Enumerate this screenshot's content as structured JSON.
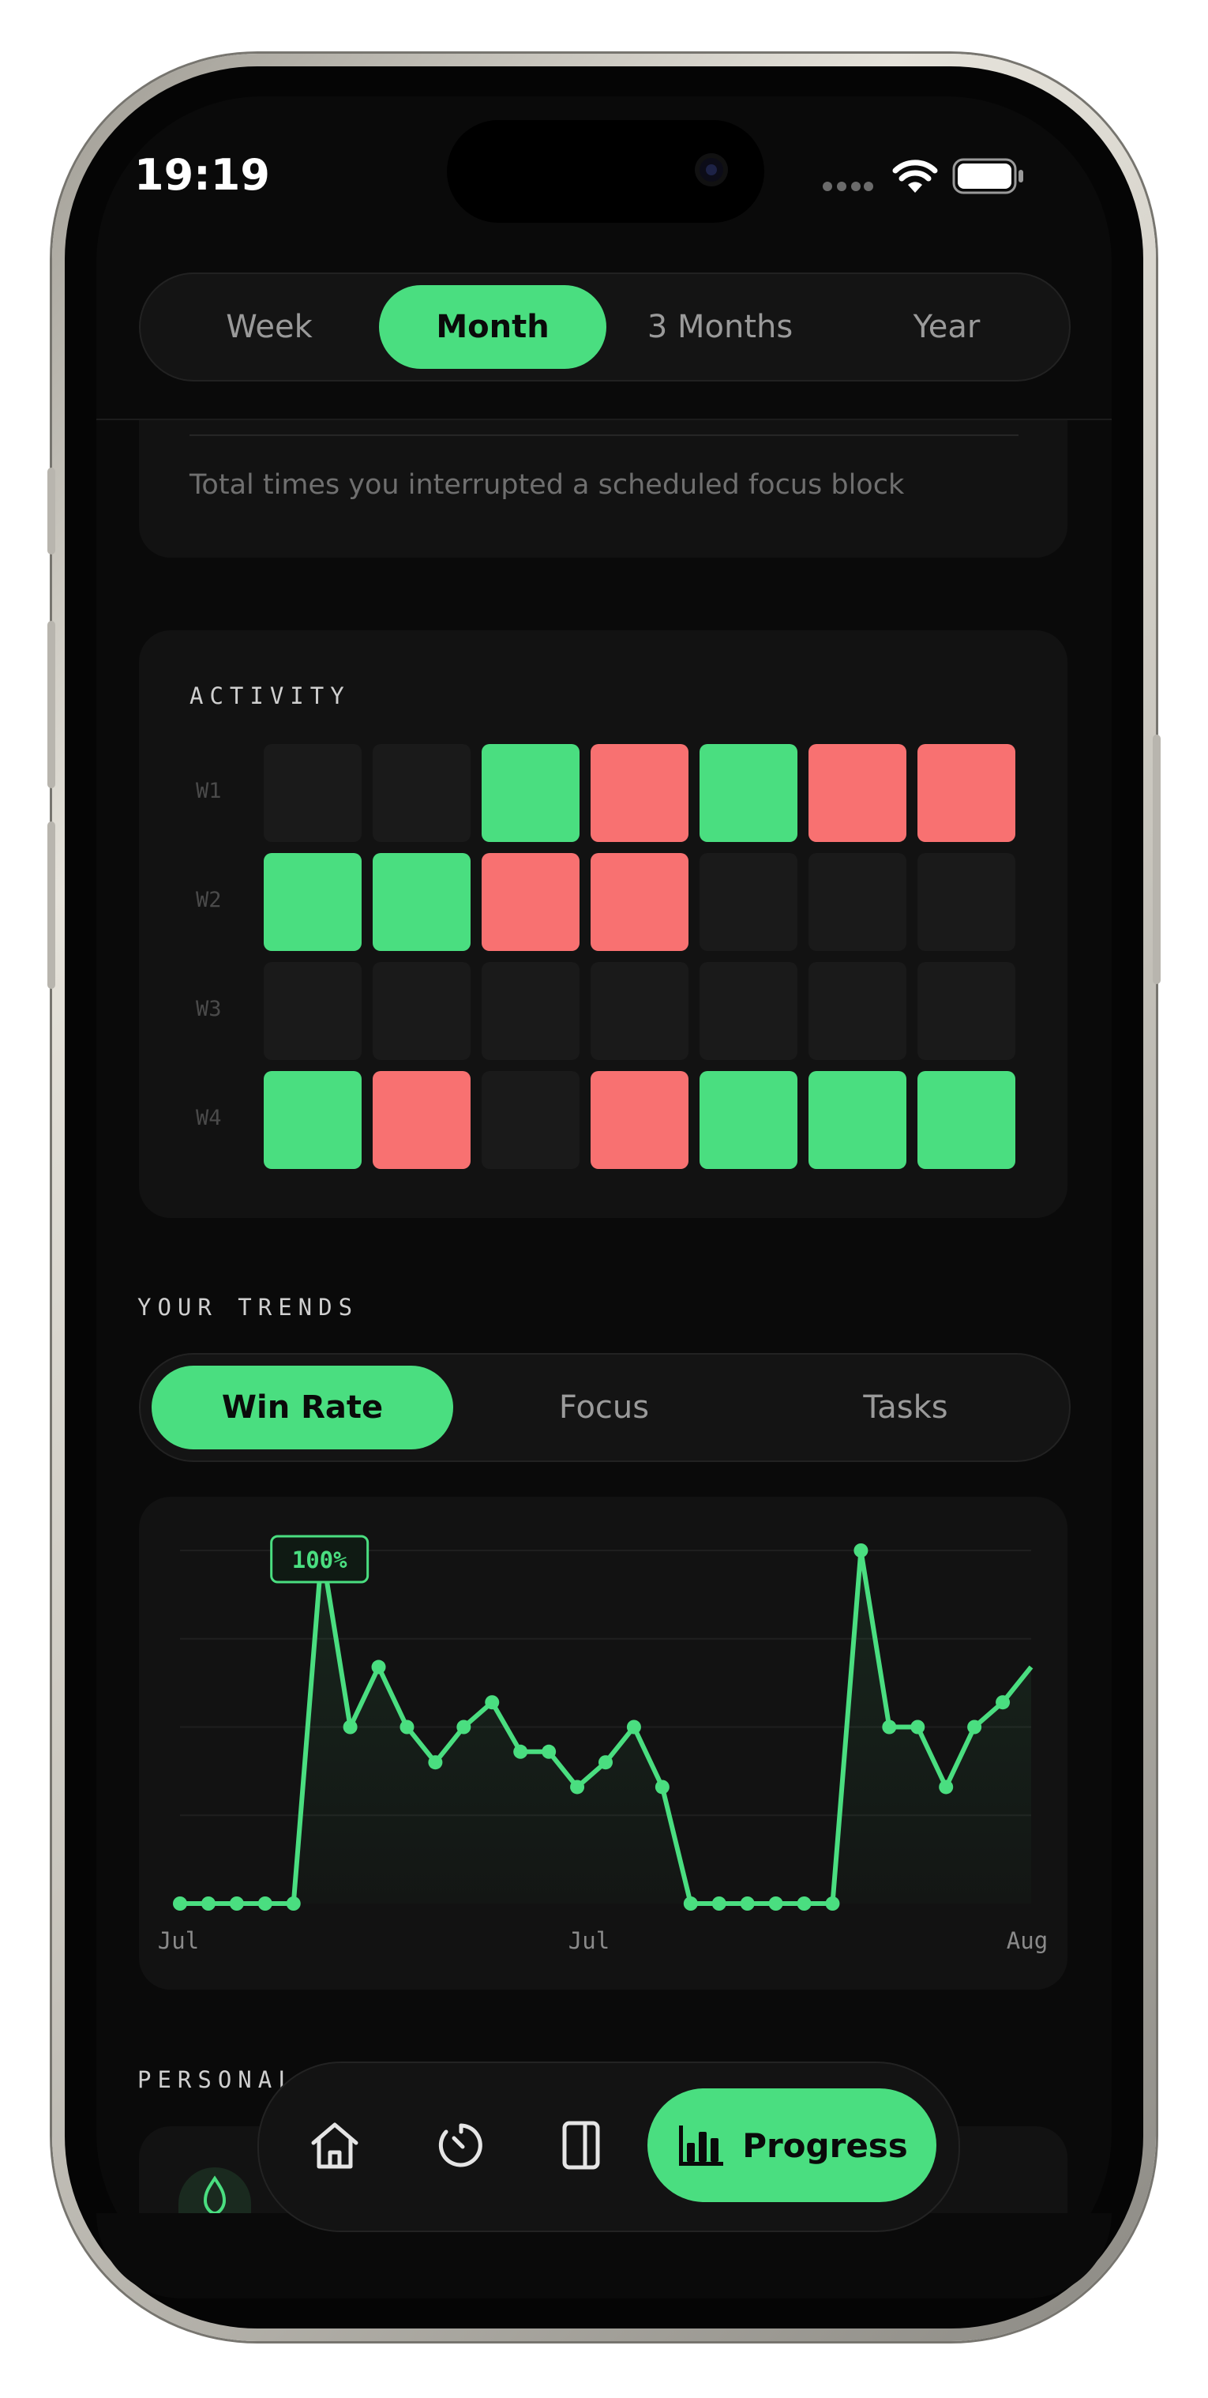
{
  "status_bar": {
    "time": "19:19"
  },
  "period_tabs": {
    "items": [
      "Week",
      "Month",
      "3 Months",
      "Year"
    ],
    "active": "Month"
  },
  "summary_card": {
    "description": "Total times you interrupted a scheduled focus block"
  },
  "activity": {
    "title": "ACTIVITY",
    "weeks": [
      {
        "label": "W1",
        "days": [
          "empty",
          "empty",
          "win",
          "loss",
          "win",
          "loss",
          "loss"
        ]
      },
      {
        "label": "W2",
        "days": [
          "win",
          "win",
          "loss",
          "loss",
          "empty",
          "empty",
          "empty"
        ]
      },
      {
        "label": "W3",
        "days": [
          "empty",
          "empty",
          "empty",
          "empty",
          "empty",
          "empty",
          "empty"
        ]
      },
      {
        "label": "W4",
        "days": [
          "win",
          "loss",
          "empty",
          "loss",
          "win",
          "win",
          "win"
        ]
      }
    ],
    "colors": {
      "win": "#4ade80",
      "loss": "#f87171",
      "empty": "#1a1a1a"
    }
  },
  "trends": {
    "title": "YOUR TRENDS",
    "tabs": [
      "Win Rate",
      "Focus",
      "Tasks"
    ],
    "active": "Win Rate"
  },
  "chart_data": {
    "type": "area",
    "series": [
      {
        "values": [
          0,
          0,
          0,
          0,
          0,
          100,
          50,
          67,
          50,
          40,
          50,
          57,
          43,
          43,
          33,
          40,
          50,
          33,
          0,
          0,
          0,
          0,
          0,
          0,
          100,
          50,
          50,
          33,
          50,
          57,
          67
        ]
      }
    ],
    "x_tick_labels": [
      "Jul",
      "Jul",
      "Aug"
    ],
    "ylim": [
      0,
      100
    ],
    "annotation": {
      "label": "100%",
      "index": 5
    },
    "grid": true,
    "color": "#4ade80"
  },
  "personal": {
    "title": "PERSONAL"
  },
  "tab_bar": {
    "items": [
      {
        "icon": "home-icon"
      },
      {
        "icon": "timer-icon"
      },
      {
        "icon": "journal-icon"
      }
    ],
    "active_label": "Progress",
    "active_icon": "bar-chart-icon"
  }
}
